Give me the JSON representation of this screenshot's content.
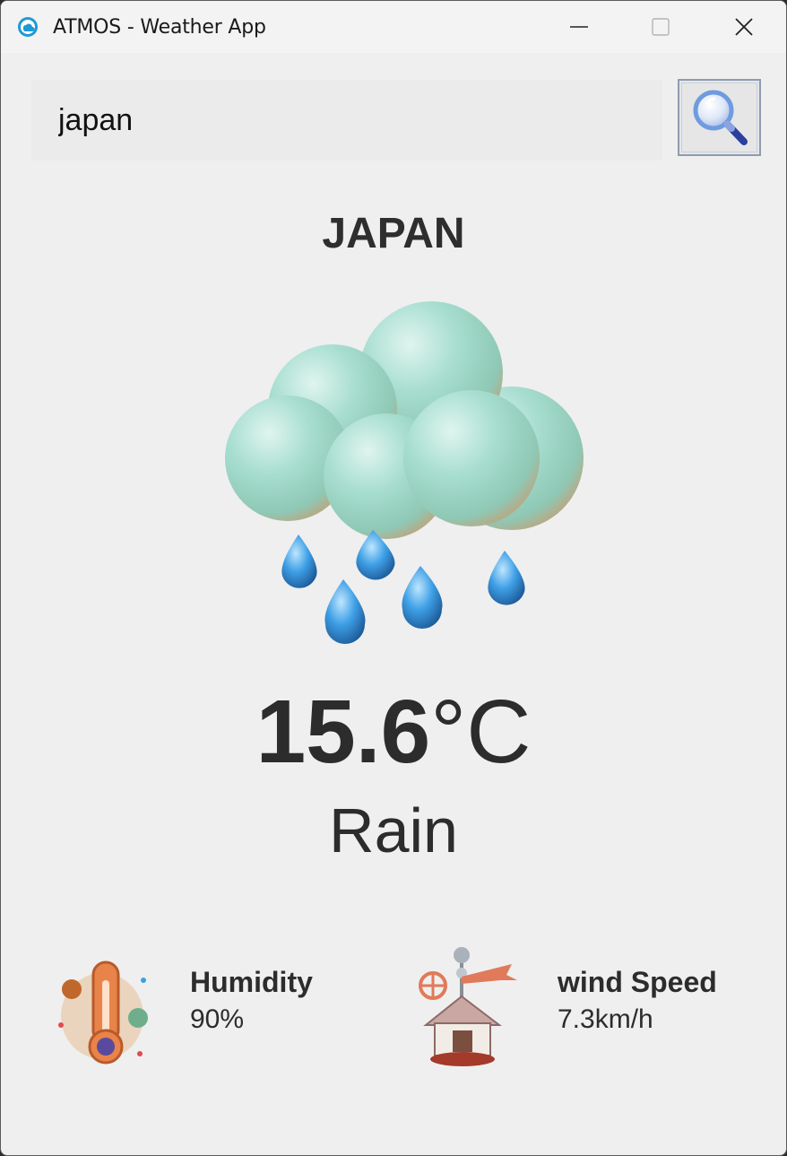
{
  "window": {
    "title": "ATMOS - Weather App",
    "app_icon": "atmos-app-icon"
  },
  "search": {
    "value": "japan",
    "button_icon": "magnifier-icon"
  },
  "weather": {
    "city": "JAPAN",
    "icon": "rain-cloud-icon",
    "temperature_value": "15.6",
    "temperature_unit": "°C",
    "condition": "Rain"
  },
  "stats": {
    "humidity": {
      "label": "Humidity",
      "value": "90%",
      "icon": "thermometer-icon"
    },
    "wind": {
      "label": "wind Speed",
      "value": "7.3km/h",
      "icon": "weather-vane-icon"
    }
  },
  "colors": {
    "background": "#efefef",
    "titlebar": "#f3f3f3",
    "text": "#2c2c2c",
    "cloud": "#a9ddd0",
    "raindrop": "#3fa0e6"
  }
}
